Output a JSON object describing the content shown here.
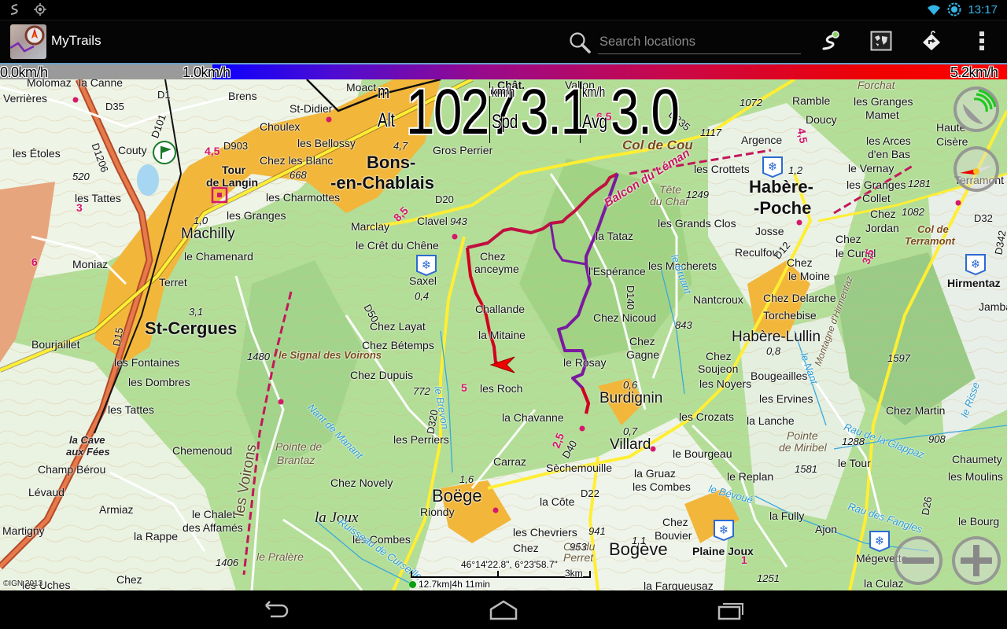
{
  "status_bar": {
    "left_icons": [
      "trail-recording-icon",
      "gps-locate-icon"
    ],
    "right_icons": [
      "wifi-icon",
      "sync-icon"
    ],
    "time": "13:17"
  },
  "action_bar": {
    "app_title": "MyTrails",
    "search": {
      "placeholder": "Search locations",
      "value": ""
    },
    "buttons": [
      {
        "name": "track-button",
        "icon": "trail-pin-icon"
      },
      {
        "name": "map-layers-button",
        "icon": "map-icon"
      },
      {
        "name": "navigate-button",
        "icon": "route-tag-icon"
      },
      {
        "name": "overflow-menu-button",
        "icon": "more-vert-icon"
      }
    ]
  },
  "speed_legend": {
    "min_label": "0.0km/h",
    "mid_label": "1.0km/h",
    "max_label": "5.2km/h",
    "colors": {
      "low": "#9a9a9a",
      "start": "#0a00ff",
      "end": "#ff0000"
    }
  },
  "hud": {
    "altitude": {
      "unit": "m",
      "label": "Alt",
      "value": "1027"
    },
    "speed": {
      "unit": "km/h",
      "label": "Spd",
      "value": "3.1"
    },
    "average": {
      "unit": "km/h",
      "label": "Avg",
      "value": "3.0"
    }
  },
  "map": {
    "coordinates": "46°14'22.8\", 6°23'58.7\"",
    "scale_label": "3km",
    "trip_summary": "12.7km|4h 11min",
    "attribution": "©IGN 2013",
    "places": [
      {
        "t": "Verrières"
      },
      {
        "t": "Molomaz"
      },
      {
        "t": "la Canne"
      },
      {
        "t": "Brens"
      },
      {
        "t": "St-Didier"
      },
      {
        "t": "Choulex"
      },
      {
        "t": "Moact"
      },
      {
        "t": "Chât."
      },
      {
        "t": "Vallon"
      },
      {
        "t": "les Bellossy"
      },
      {
        "t": "Chez les Blanc"
      },
      {
        "t": "Tour"
      },
      {
        "t": "de Langin"
      },
      {
        "t": "Couty"
      },
      {
        "t": "les Étoles"
      },
      {
        "t": "les Tattes"
      },
      {
        "t": "les Charmottes"
      },
      {
        "t": "les Granges"
      },
      {
        "t": "Machilly"
      },
      {
        "t": "le Chamenard"
      },
      {
        "t": "Moniaz"
      },
      {
        "t": "Terret"
      },
      {
        "t": "St-Cergues"
      },
      {
        "t": "Bourjaillet"
      },
      {
        "t": "Bons-"
      },
      {
        "t": "-en-Chablais"
      },
      {
        "t": "Gros Perrier"
      },
      {
        "t": "Marclay"
      },
      {
        "t": "Clavel"
      },
      {
        "t": "le Crêt du Chêne"
      },
      {
        "t": "Saxel"
      },
      {
        "t": "Chez Layat"
      },
      {
        "t": "Chez Bétemps"
      },
      {
        "t": "le Signal des Voirons"
      },
      {
        "t": "Chez Dupuis"
      },
      {
        "t": "les Fontaines"
      },
      {
        "t": "les Dombres"
      },
      {
        "t": "les Tattes "
      },
      {
        "t": "la Cave"
      },
      {
        "t": "aux Fées"
      },
      {
        "t": "Chemenoud"
      },
      {
        "t": "Champ Bérou"
      },
      {
        "t": "Lévaud"
      },
      {
        "t": "Armiaz"
      },
      {
        "t": "Martigny"
      },
      {
        "t": "le Chalet"
      },
      {
        "t": "des Affamés"
      },
      {
        "t": "la Rappe"
      },
      {
        "t": "les Uches"
      },
      {
        "t": "Pointe de"
      },
      {
        "t": "Brantaz"
      },
      {
        "t": "les Perriers"
      },
      {
        "t": "Chez Novely"
      },
      {
        "t": "la Joux"
      },
      {
        "t": "les Combes"
      },
      {
        "t": "le Pralère"
      },
      {
        "t": "Chez"
      },
      {
        "t": "Chez"
      },
      {
        "t": "anceyme"
      },
      {
        "t": "Challande"
      },
      {
        "t": "la Mitaine"
      },
      {
        "t": "les Roch"
      },
      {
        "t": "la Chavanne"
      },
      {
        "t": "la Tataz"
      },
      {
        "t": "l'Espérance"
      },
      {
        "t": "Chez Nicoud"
      },
      {
        "t": "Chez"
      },
      {
        "t": "Gagne"
      },
      {
        "t": "le Rosay"
      },
      {
        "t": "Burdignin"
      },
      {
        "t": "Carraz"
      },
      {
        "t": "Boëge"
      },
      {
        "t": "Riondy"
      },
      {
        "t": "Sèchemouille"
      },
      {
        "t": "Villard"
      },
      {
        "t": "le Bourgeau"
      },
      {
        "t": "la Gruaz"
      },
      {
        "t": "les Combes "
      },
      {
        "t": "la Côte"
      },
      {
        "t": "les Chevriers"
      },
      {
        "t": "Chez"
      },
      {
        "t": "Col du"
      },
      {
        "t": "Perret"
      },
      {
        "t": "Bogève"
      },
      {
        "t": "Chez"
      },
      {
        "t": "Bouvier"
      },
      {
        "t": "Plaine Joux"
      },
      {
        "t": "la Fargueusaz"
      },
      {
        "t": "Col de Cou"
      },
      {
        "t": "Balcon du Léman"
      },
      {
        "t": "Tête"
      },
      {
        "t": "du Char"
      },
      {
        "t": "les Grands Clos"
      },
      {
        "t": "les Macherets"
      },
      {
        "t": "Nantcroux"
      },
      {
        "t": "Ramble"
      },
      {
        "t": "Doucy"
      },
      {
        "t": "Argence"
      },
      {
        "t": "les Crottets"
      },
      {
        "t": "Habère-"
      },
      {
        "t": "-Poche"
      },
      {
        "t": "Josse"
      },
      {
        "t": "Reculfou"
      },
      {
        "t": "Chez"
      },
      {
        "t": "le Moine"
      },
      {
        "t": "Chez Delarche"
      },
      {
        "t": "Torchebise"
      },
      {
        "t": "Habère-Lullin"
      },
      {
        "t": "Chez"
      },
      {
        "t": "Soujeon"
      },
      {
        "t": "les Noyers"
      },
      {
        "t": "Bougeailles"
      },
      {
        "t": "les Ervines"
      },
      {
        "t": "les Crozats"
      },
      {
        "t": "la Lanche"
      },
      {
        "t": "Pointe"
      },
      {
        "t": "de Miribel"
      },
      {
        "t": "le Replan"
      },
      {
        "t": "le Tour"
      },
      {
        "t": "la Fully"
      },
      {
        "t": "Ajon"
      },
      {
        "t": "Chez Martin"
      },
      {
        "t": "Chaumety"
      },
      {
        "t": "les Moulins"
      },
      {
        "t": "le Bourg"
      },
      {
        "t": "Mégevette"
      },
      {
        "t": "la Culaz"
      },
      {
        "t": "les Granges"
      },
      {
        "t": "Mamet"
      },
      {
        "t": "les Arces"
      },
      {
        "t": "d'en Bas"
      },
      {
        "t": "le Vernay"
      },
      {
        "t": "les Granges"
      },
      {
        "t": "Collet"
      },
      {
        "t": "Chez"
      },
      {
        "t": "Jordan"
      },
      {
        "t": "Chez"
      },
      {
        "t": "le Curial"
      },
      {
        "t": "Col de"
      },
      {
        "t": "Terramont"
      },
      {
        "t": "Hirmentaz"
      },
      {
        "t": "Jambaz"
      },
      {
        "t": "Haute"
      },
      {
        "t": "Cisère"
      },
      {
        "t": "Forchat"
      },
      {
        "t": "Terramont"
      },
      {
        "t": "les Voirons"
      },
      {
        "t": "le Brevon"
      },
      {
        "t": "Nant de Manant"
      },
      {
        "t": "Ruisseau de Curseille"
      },
      {
        "t": "Rau de la Glappaz"
      },
      {
        "t": "Rau des Fangles"
      },
      {
        "t": "le Nant"
      },
      {
        "t": "le Bruant"
      },
      {
        "t": "le Bévoué"
      },
      {
        "t": "le Risse"
      },
      {
        "t": "Montagne d'Hirmentaz"
      }
    ],
    "elevations": [
      "1072",
      "1117",
      "1249",
      "1281",
      "1082",
      "843",
      "1597",
      "1288",
      "1581",
      "908",
      "1480",
      "1406",
      "941",
      "953",
      "1251",
      "520",
      "668",
      "943",
      "772",
      "0,4",
      "3,1",
      "1,0",
      "4,7",
      "1,6",
      "0,6",
      "0,7",
      "0,8",
      "1,1",
      "1,2"
    ],
    "roads": [
      "D35",
      "D1",
      "D101",
      "D1206",
      "D903",
      "D20",
      "D50",
      "D320",
      "D40",
      "D22",
      "D12",
      "D140",
      "D235",
      "D32",
      "D342",
      "D26",
      "D15"
    ],
    "route_distances": [
      "4,5",
      "8,5",
      "3",
      "6",
      "2,5",
      "3,5",
      "4,5",
      "5",
      "1",
      "6,5"
    ]
  },
  "map_controls": {
    "gps_status": "gps-signal-icon",
    "compass": "compass-icon",
    "zoom_out": "zoom-out-icon",
    "zoom_in": "zoom-in-icon"
  },
  "nav_bar": {
    "buttons": [
      "back-icon",
      "home-icon",
      "recent-apps-icon"
    ]
  }
}
